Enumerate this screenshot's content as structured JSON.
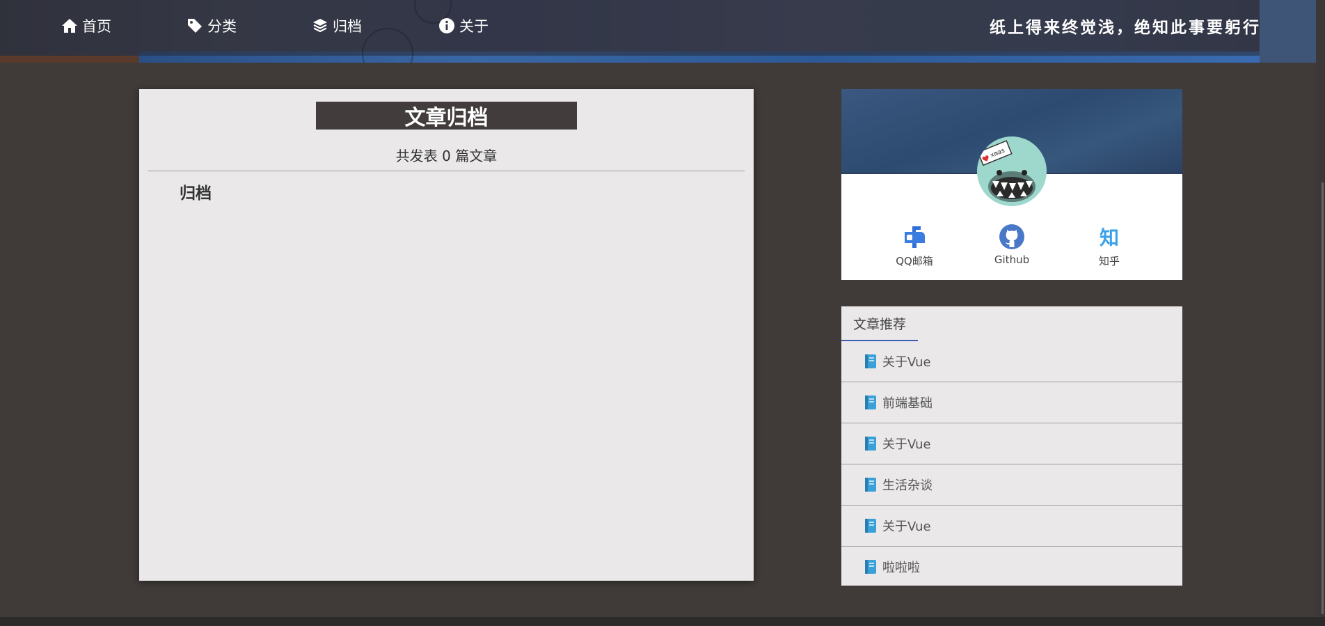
{
  "nav": {
    "items": [
      {
        "label": "首页",
        "icon": "home-icon"
      },
      {
        "label": "分类",
        "icon": "tag-icon"
      },
      {
        "label": "归档",
        "icon": "layers-icon"
      },
      {
        "label": "关于",
        "icon": "info-icon"
      }
    ],
    "slogan": "纸上得来终觉浅，绝知此事要躬行"
  },
  "main": {
    "title": "文章归档",
    "subtitle": "共发表 0 篇文章",
    "section_heading": "归档"
  },
  "profile": {
    "avatar_icon": "avatar-monster-xmas",
    "avatar_badge": "xmas",
    "links": [
      {
        "label": "QQ邮箱",
        "icon": "mailbox-icon"
      },
      {
        "label": "Github",
        "icon": "github-icon"
      },
      {
        "label": "知乎",
        "icon": "zhihu-icon",
        "glyph": "知"
      }
    ]
  },
  "recommend": {
    "tab": "文章推荐",
    "items": [
      {
        "label": "关于Vue",
        "icon": "book-icon"
      },
      {
        "label": "前端基础",
        "icon": "book-icon"
      },
      {
        "label": "关于Vue",
        "icon": "book-icon"
      },
      {
        "label": "生活杂谈",
        "icon": "book-icon"
      },
      {
        "label": "关于Vue",
        "icon": "book-icon"
      },
      {
        "label": "啦啦啦",
        "icon": "book-icon"
      }
    ]
  },
  "colors": {
    "page_bg": "#403a39",
    "card_bg": "#eae8e9",
    "title_bg": "#433c3c",
    "accent": "#3a5fb0",
    "zhihu": "#3aa2e9",
    "github": "#4a78c8"
  }
}
